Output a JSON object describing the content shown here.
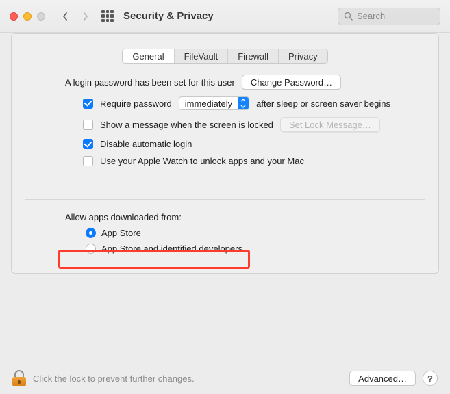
{
  "window": {
    "title": "Security & Privacy"
  },
  "search": {
    "placeholder": "Search"
  },
  "tabs": [
    {
      "label": "General",
      "active": true
    },
    {
      "label": "FileVault",
      "active": false
    },
    {
      "label": "Firewall",
      "active": false
    },
    {
      "label": "Privacy",
      "active": false
    }
  ],
  "login": {
    "text": "A login password has been set for this user",
    "change_button": "Change Password…"
  },
  "options": {
    "require_password": {
      "checked": true,
      "prefix": "Require password",
      "select_value": "immediately",
      "suffix": "after sleep or screen saver begins"
    },
    "show_message": {
      "checked": false,
      "label": "Show a message when the screen is locked",
      "button": "Set Lock Message…",
      "button_enabled": false
    },
    "disable_auto_login": {
      "checked": true,
      "label": "Disable automatic login"
    },
    "apple_watch": {
      "checked": false,
      "label": "Use your Apple Watch to unlock apps and your Mac"
    }
  },
  "allow_apps": {
    "title": "Allow apps downloaded from:",
    "selected": "app_store",
    "choices": {
      "app_store": "App Store",
      "identified": "App Store and identified developers"
    }
  },
  "footer": {
    "lock_text": "Click the lock to prevent further changes.",
    "advanced": "Advanced…"
  },
  "colors": {
    "accent": "#0a7bff",
    "highlight": "#ff3b2c"
  }
}
